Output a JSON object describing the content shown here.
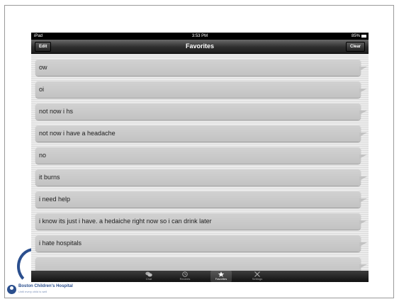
{
  "status_bar": {
    "device": "iPad",
    "time": "3:53 PM",
    "battery": "85%"
  },
  "nav": {
    "edit_label": "Edit",
    "title": "Favorites",
    "clear_label": "Clear"
  },
  "favorites": [
    "ow",
    "oi",
    "not now i hs",
    "not now i have  a headache",
    "no",
    "it burns",
    "i need help",
    "i know its just i have. a hedaiche right now so i can drink later",
    "i hate hospitals"
  ],
  "tabs": [
    {
      "label": "Chat",
      "icon": "chat-bubbles-icon"
    },
    {
      "label": "Recents",
      "icon": "clock-icon"
    },
    {
      "label": "Favorites",
      "icon": "star-icon",
      "active": true
    },
    {
      "label": "Settings",
      "icon": "tools-icon"
    }
  ],
  "branding": {
    "name": "Boston Children's Hospital",
    "tagline": "Until every child is well"
  },
  "colors": {
    "brand_blue": "#2b4f8e",
    "bubble": "#c6c6c6",
    "bar": "#1c1c1c"
  }
}
